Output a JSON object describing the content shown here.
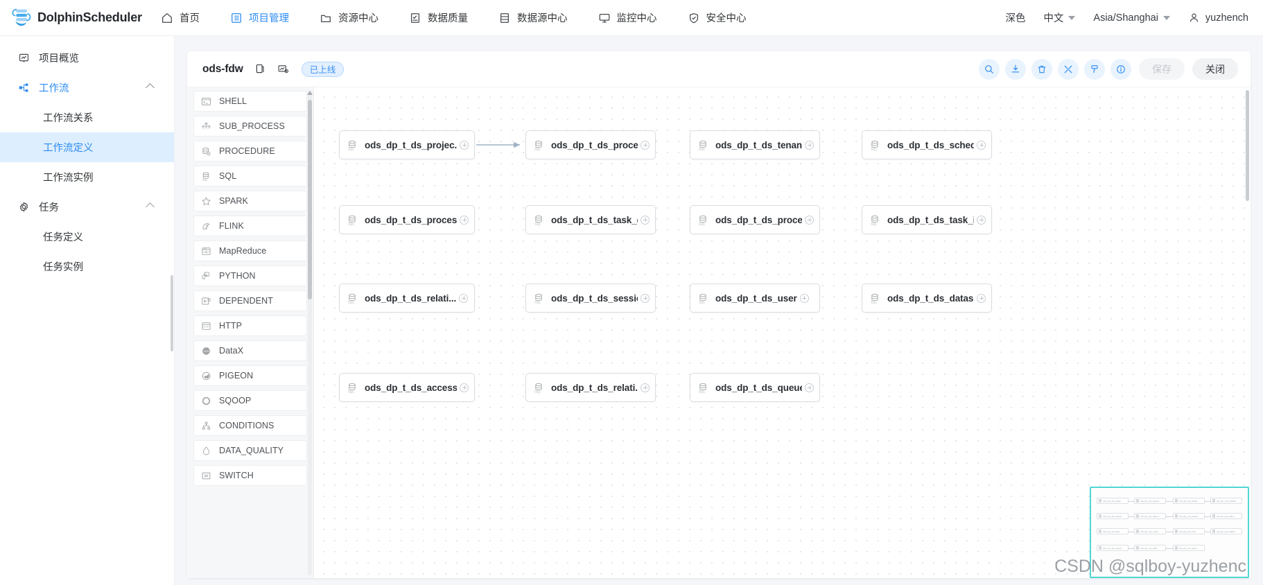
{
  "header": {
    "brand": "DolphinScheduler",
    "logo_icon": "dolphin-logo",
    "nav": [
      {
        "label": "首页",
        "icon": "home-icon",
        "active": false
      },
      {
        "label": "项目管理",
        "icon": "list-box-icon",
        "active": true
      },
      {
        "label": "资源中心",
        "icon": "folder-icon",
        "active": false
      },
      {
        "label": "数据质量",
        "icon": "quality-check-icon",
        "active": false
      },
      {
        "label": "数据源中心",
        "icon": "database-stack-icon",
        "active": false
      },
      {
        "label": "监控中心",
        "icon": "monitor-icon",
        "active": false
      },
      {
        "label": "安全中心",
        "icon": "shield-check-icon",
        "active": false
      }
    ],
    "right": {
      "theme_label": "深色",
      "language_label": "中文",
      "timezone_label": "Asia/Shanghai",
      "user_label": "yuzhench",
      "user_icon": "user-icon"
    }
  },
  "sidebar": {
    "items": [
      {
        "label": "项目概览",
        "icon": "overview-icon",
        "level": "top",
        "state": "normal"
      },
      {
        "label": "工作流",
        "icon": "workflow-icon",
        "level": "top",
        "state": "group-open"
      },
      {
        "label": "工作流关系",
        "icon": "",
        "level": "sub",
        "state": "normal"
      },
      {
        "label": "工作流定义",
        "icon": "",
        "level": "sub",
        "state": "selected"
      },
      {
        "label": "工作流实例",
        "icon": "",
        "level": "sub",
        "state": "normal"
      },
      {
        "label": "任务",
        "icon": "gear-icon",
        "level": "top",
        "state": "group-open"
      },
      {
        "label": "任务定义",
        "icon": "",
        "level": "sub",
        "state": "normal"
      },
      {
        "label": "任务实例",
        "icon": "",
        "level": "sub",
        "state": "normal"
      }
    ]
  },
  "workflow_header": {
    "name": "ods-fdw",
    "copy_icon": "copy-icon",
    "version_icon": "version-graph-icon",
    "status_badge": "已上线",
    "tools": [
      {
        "name": "search-icon",
        "title": "搜索"
      },
      {
        "name": "download-icon",
        "title": "下载"
      },
      {
        "name": "trash-icon",
        "title": "删除"
      },
      {
        "name": "shrink-icon",
        "title": "全屏"
      },
      {
        "name": "format-layout-icon",
        "title": "格式化"
      },
      {
        "name": "info-icon",
        "title": "说明"
      }
    ],
    "save_label": "保存",
    "close_label": "关闭"
  },
  "task_types": [
    {
      "label": "SHELL",
      "icon": "terminal-icon"
    },
    {
      "label": "SUB_PROCESS",
      "icon": "subprocess-tree-icon"
    },
    {
      "label": "PROCEDURE",
      "icon": "procedure-db-icon"
    },
    {
      "label": "SQL",
      "icon": "sql-db-icon"
    },
    {
      "label": "SPARK",
      "icon": "spark-star-icon"
    },
    {
      "label": "FLINK",
      "icon": "flink-squirrel-icon"
    },
    {
      "label": "MapReduce",
      "icon": "mapreduce-icon"
    },
    {
      "label": "PYTHON",
      "icon": "python-icon"
    },
    {
      "label": "DEPENDENT",
      "icon": "dependent-arrow-icon"
    },
    {
      "label": "HTTP",
      "icon": "http-icon"
    },
    {
      "label": "DataX",
      "icon": "datax-circle-icon"
    },
    {
      "label": "PIGEON",
      "icon": "pigeon-icon"
    },
    {
      "label": "SQOOP",
      "icon": "sqoop-ring-icon"
    },
    {
      "label": "CONDITIONS",
      "icon": "conditions-branch-icon"
    },
    {
      "label": "DATA_QUALITY",
      "icon": "water-drop-icon"
    },
    {
      "label": "SWITCH",
      "icon": "switch-box-icon"
    }
  ],
  "dag": {
    "node_icon": "sql-db-icon",
    "rows": [
      [
        "ods_dp_t_ds_projec.",
        "ods_dp_t_ds_proces.",
        "ods_dp_t_ds_tenant",
        "ods_dp_t_ds_schedu."
      ],
      [
        "ods_dp_t_ds_proces.",
        "ods_dp_t_ds_task_d.",
        "ods_dp_t_ds_proces.",
        "ods_dp_t_ds_task_i..."
      ],
      [
        "ods_dp_t_ds_relati...",
        "ods_dp_t_ds_sessio.",
        "ods_dp_t_ds_user",
        "ods_dp_t_ds_dataso."
      ],
      [
        "ods_dp_t_ds_access.",
        "ods_dp_t_ds_relati...",
        "ods_dp_t_ds_queue"
      ]
    ]
  },
  "minimap": {
    "border_color": "#4fd6d2",
    "rows": [
      [
        "ods_dp_t_ds_projec",
        "ods_dp_t_ds_proces",
        "ods_dp_t_ds_tenant",
        "ods_dp_t_ds_schedu"
      ],
      [
        "ods_dp_t_ds_proces",
        "ods_dp_t_ds_task_d",
        "ods_dp_t_ds_proces",
        "ods_dp_t_ds_task_i"
      ],
      [
        "ods_dp_t_ds_relati",
        "ods_dp_t_ds_sessio",
        "ods_dp_t_ds_user",
        "ods_dp_t_ds_dataso"
      ],
      [
        "ods_dp_t_ds_access",
        "ods_dp_t_ds_relati",
        "ods_dp_t_ds_queue"
      ]
    ]
  },
  "watermark": "CSDN @sqlboy-yuzhenc",
  "colors": {
    "accent": "#2d8cf0",
    "selected_bg": "#ddeeff",
    "canvas_bg": "#ffffff",
    "main_bg": "#f4f6f9",
    "minimap_border": "#4fd6d2"
  }
}
